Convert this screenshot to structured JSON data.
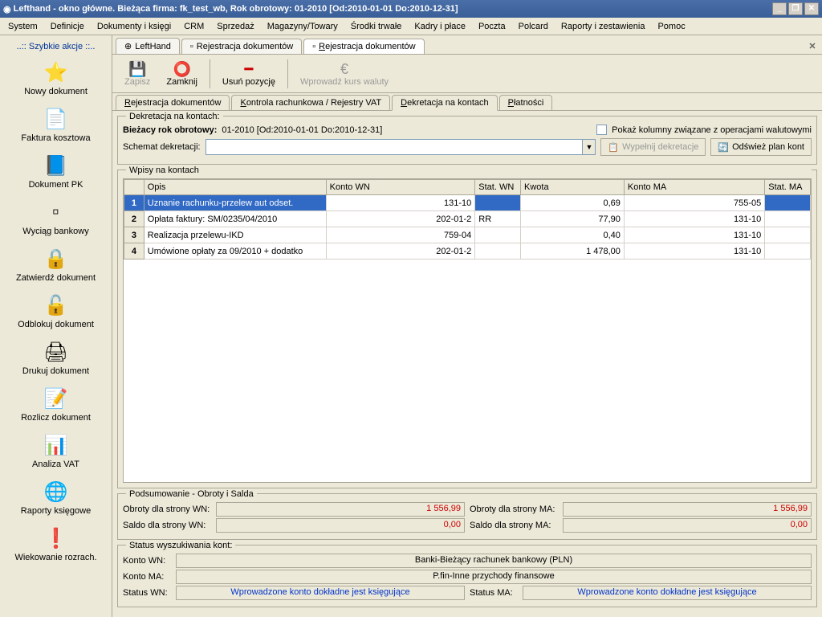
{
  "title": "Lefthand - okno główne. Bieżąca firma: fk_test_wb, Rok obrotowy: 01-2010 [Od:2010-01-01 Do:2010-12-31]",
  "menu": [
    "System",
    "Definicje",
    "Dokumenty i księgi",
    "CRM",
    "Sprzedaż",
    "Magazyny/Towary",
    "Środki trwałe",
    "Kadry i płace",
    "Poczta",
    "Polcard",
    "Raporty i zestawienia",
    "Pomoc"
  ],
  "sidebar": {
    "title": "..:: Szybkie akcje ::..",
    "items": [
      {
        "label": "Nowy dokument",
        "icon": "⭐"
      },
      {
        "label": "Faktura kosztowa",
        "icon": "📄"
      },
      {
        "label": "Dokument PK",
        "icon": "📘"
      },
      {
        "label": "Wyciąg bankowy",
        "icon": "▫"
      },
      {
        "label": "Zatwierdź dokument",
        "icon": "🔒"
      },
      {
        "label": "Odblokuj dokument",
        "icon": "🔓"
      },
      {
        "label": "Drukuj dokument",
        "icon": "🖨"
      },
      {
        "label": "Rozlicz dokument",
        "icon": "📝"
      },
      {
        "label": "Analiza VAT",
        "icon": "📊"
      },
      {
        "label": "Raporty księgowe",
        "icon": "🌐"
      },
      {
        "label": "Wiekowanie rozrach.",
        "icon": "❗"
      }
    ]
  },
  "doctabs": [
    {
      "label": "LeftHand",
      "icon": "⊕"
    },
    {
      "label": "Rejestracja dokumentów",
      "icon": "▫"
    },
    {
      "label": "Rejestracja dokumentów",
      "icon": "▫",
      "active": true
    }
  ],
  "toolbar": {
    "zapisz": "Zapisz",
    "zamknij": "Zamknij",
    "usun": "Usuń pozycję",
    "kurs": "Wprowadź kurs waluty"
  },
  "subtabs": [
    {
      "label": "Rejestracja dokumentów",
      "u": "R"
    },
    {
      "label": "Kontrola rachunkowa / Rejestry VAT",
      "u": "K"
    },
    {
      "label": "Dekretacja na kontach",
      "u": "D",
      "active": true
    },
    {
      "label": "Płatności",
      "u": "P"
    }
  ],
  "dekretacja": {
    "title": "Dekretacja na kontach:",
    "rok_label": "Bieżacy rok obrotowy:",
    "rok_value": "01-2010 [Od:2010-01-01 Do:2010-12-31]",
    "checkbox_label": "Pokaż kolumny związane z operacjami walutowymi",
    "schemat_label": "Schemat dekretacji:",
    "btn_wypelnij": "Wypełnij dekretacje",
    "btn_odswiez": "Odśwież plan kont"
  },
  "grid": {
    "title": "Wpisy na kontach",
    "cols": [
      "",
      "Opis",
      "Konto WN",
      "Stat. WN",
      "Kwota",
      "Konto MA",
      "Stat. MA"
    ],
    "rows": [
      {
        "n": "1",
        "opis": "Uznanie rachunku-przelew aut odset.",
        "wn": "131-10",
        "statwn": "",
        "kwota": "0,69",
        "ma": "755-05",
        "statma": "",
        "sel": true
      },
      {
        "n": "2",
        "opis": "Opłata faktury: SM/0235/04/2010",
        "wn": "202-01-2",
        "statwn": "RR",
        "kwota": "77,90",
        "ma": "131-10",
        "statma": ""
      },
      {
        "n": "3",
        "opis": "Realizacja przelewu-IKD",
        "wn": "759-04",
        "statwn": "",
        "kwota": "0,40",
        "ma": "131-10",
        "statma": ""
      },
      {
        "n": "4",
        "opis": "Umówione opłaty za 09/2010 + dodatko",
        "wn": "202-01-2",
        "statwn": "",
        "kwota": "1 478,00",
        "ma": "131-10",
        "statma": ""
      }
    ]
  },
  "summary": {
    "title": "Podsumowanie - Obroty i Salda",
    "obroty_wn_label": "Obroty dla strony WN:",
    "obroty_wn": "1 556,99",
    "obroty_ma_label": "Obroty dla strony MA:",
    "obroty_ma": "1 556,99",
    "saldo_wn_label": "Saldo dla strony WN:",
    "saldo_wn": "0,00",
    "saldo_ma_label": "Saldo dla strony MA:",
    "saldo_ma": "0,00"
  },
  "status": {
    "title": "Status wyszukiwania kont:",
    "konto_wn_label": "Konto WN:",
    "konto_wn": "Banki-Bieżący rachunek bankowy (PLN)",
    "konto_ma_label": "Konto MA:",
    "konto_ma": "P.fin-Inne przychody finansowe",
    "status_wn_label": "Status WN:",
    "status_wn": "Wprowadzone konto dokładne jest księgujące",
    "status_ma_label": "Status MA:",
    "status_ma": "Wprowadzone konto dokładne jest księgujące"
  }
}
